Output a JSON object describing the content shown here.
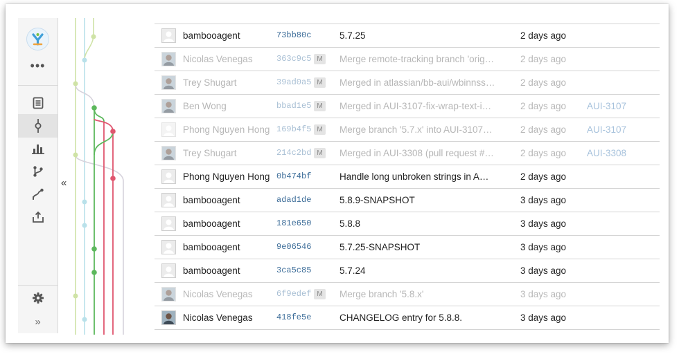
{
  "sidebar": {
    "logo_icon": "atlassian-logo-icon",
    "more_label": "•••",
    "expand_label": "»",
    "nav": [
      {
        "icon": "source-icon",
        "active": false
      },
      {
        "icon": "commits-icon",
        "active": true
      },
      {
        "icon": "chart-icon",
        "active": false
      },
      {
        "icon": "branches-icon",
        "active": false
      },
      {
        "icon": "pull-requests-icon",
        "active": false
      },
      {
        "icon": "upload-icon",
        "active": false
      }
    ],
    "settings_icon": "gear-icon"
  },
  "collapse_label": "«",
  "commits": [
    {
      "author": "bambooagent",
      "hash": "73bb80c",
      "merge": false,
      "message": "5.7.25",
      "time": "2 days ago",
      "tag": "",
      "avatar": "default"
    },
    {
      "author": "Nicolas Venegas",
      "hash": "363c9c5",
      "merge": true,
      "merge_label": "M",
      "message": "Merge remote-tracking branch 'origin/...",
      "time": "2 days ago",
      "tag": "",
      "avatar": "photo"
    },
    {
      "author": "Trey Shugart",
      "hash": "39ad0a5",
      "merge": true,
      "merge_label": "M",
      "message": "Merged in atlassian/bb-aui/wbinnssmi...",
      "time": "2 days ago",
      "tag": "",
      "avatar": "photo"
    },
    {
      "author": "Ben Wong",
      "hash": "bbad1e5",
      "merge": true,
      "merge_label": "M",
      "message": "Merged in AUI-3107-fix-wrap-text-in-t...",
      "time": "2 days ago",
      "tag": "AUI-3107",
      "avatar": "photo"
    },
    {
      "author": "Phong Nguyen Hong",
      "hash": "169b4f5",
      "merge": true,
      "merge_label": "M",
      "message": "Merge branch '5.7.x' into AUI-3107-fi...",
      "time": "2 days ago",
      "tag": "AUI-3107",
      "avatar": "default"
    },
    {
      "author": "Trey Shugart",
      "hash": "214c2bd",
      "merge": true,
      "merge_label": "M",
      "message": "Merged in AUI-3308 (pull request #1...",
      "time": "2 days ago",
      "tag": "AUI-3308",
      "avatar": "photo"
    },
    {
      "author": "Phong Nguyen Hong",
      "hash": "0b474bf",
      "merge": false,
      "message": "Handle long unbroken strings in AUI ...",
      "time": "2 days ago",
      "tag": "",
      "avatar": "default"
    },
    {
      "author": "bambooagent",
      "hash": "adad1de",
      "merge": false,
      "message": "5.8.9-SNAPSHOT",
      "time": "3 days ago",
      "tag": "",
      "avatar": "default"
    },
    {
      "author": "bambooagent",
      "hash": "181e650",
      "merge": false,
      "message": "5.8.8",
      "time": "3 days ago",
      "tag": "",
      "avatar": "default"
    },
    {
      "author": "bambooagent",
      "hash": "9e06546",
      "merge": false,
      "message": "5.7.25-SNAPSHOT",
      "time": "3 days ago",
      "tag": "",
      "avatar": "default"
    },
    {
      "author": "bambooagent",
      "hash": "3ca5c85",
      "merge": false,
      "message": "5.7.24",
      "time": "3 days ago",
      "tag": "",
      "avatar": "default"
    },
    {
      "author": "Nicolas Venegas",
      "hash": "6f9edef",
      "merge": true,
      "merge_label": "M",
      "message": "Merge branch '5.8.x'",
      "time": "3 days ago",
      "tag": "",
      "avatar": "photo"
    },
    {
      "author": "Nicolas Venegas",
      "hash": "418fe5e",
      "merge": false,
      "message": "CHANGELOG entry for 5.8.8.",
      "time": "3 days ago",
      "tag": "",
      "avatar": "photo"
    }
  ],
  "graph_colors": {
    "green": "#5cb85c",
    "red": "#e0566f",
    "lightgreen": "#cfe3a6",
    "lightblue": "#b9e1ea",
    "grey": "#d6d2dc"
  }
}
